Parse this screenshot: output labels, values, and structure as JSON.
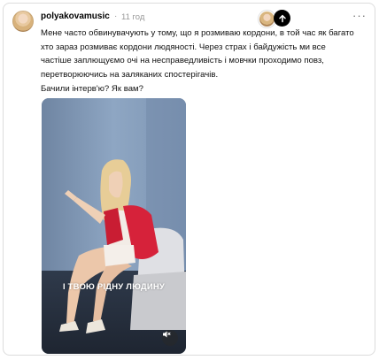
{
  "post": {
    "username": "polyakovamusic",
    "dot": "·",
    "time": "11 год",
    "text": "Мене часто обвинувачують у тому, що я розмиваю кордони, в той час як багато хто зараз розмиває кордони людяності. Через страх і байдужість ми все частіше заплющуємо очі на несправедливість і мовчки проходимо повз, перетворюючись на заляканих спостерігачів.",
    "question": "Бачили інтерв'ю? Як вам?",
    "more_label": "···",
    "video": {
      "caption": "І ТВОЮ РІДНУ ЛЮДИНУ"
    }
  },
  "icons": {
    "up": "arrow-up-icon",
    "mute": "speaker-muted-icon",
    "more": "more-horizontal-icon"
  },
  "colors": {
    "text": "#111111",
    "muted": "#9a9a9a",
    "jacket": "#d6223a",
    "background": "#ffffff"
  }
}
